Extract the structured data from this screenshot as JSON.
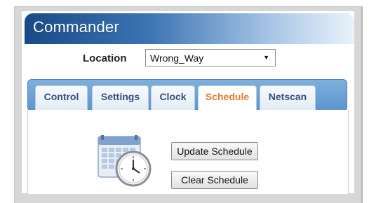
{
  "header": {
    "title": "Commander"
  },
  "location": {
    "label": "Location",
    "value": "Wrong_Way"
  },
  "tabs": [
    {
      "label": "Control",
      "active": false
    },
    {
      "label": "Settings",
      "active": false
    },
    {
      "label": "Clock",
      "active": false
    },
    {
      "label": "Schedule",
      "active": true
    },
    {
      "label": "Netscan",
      "active": false
    }
  ],
  "schedule": {
    "update_label": "Update Schedule",
    "clear_label": "Clear Schedule",
    "icon": "calendar-clock-icon"
  },
  "colors": {
    "header_dark": "#184b86",
    "tab_bar": "#5a95cf",
    "active_tab_text": "#e07a2e",
    "tab_text": "#34507a"
  }
}
